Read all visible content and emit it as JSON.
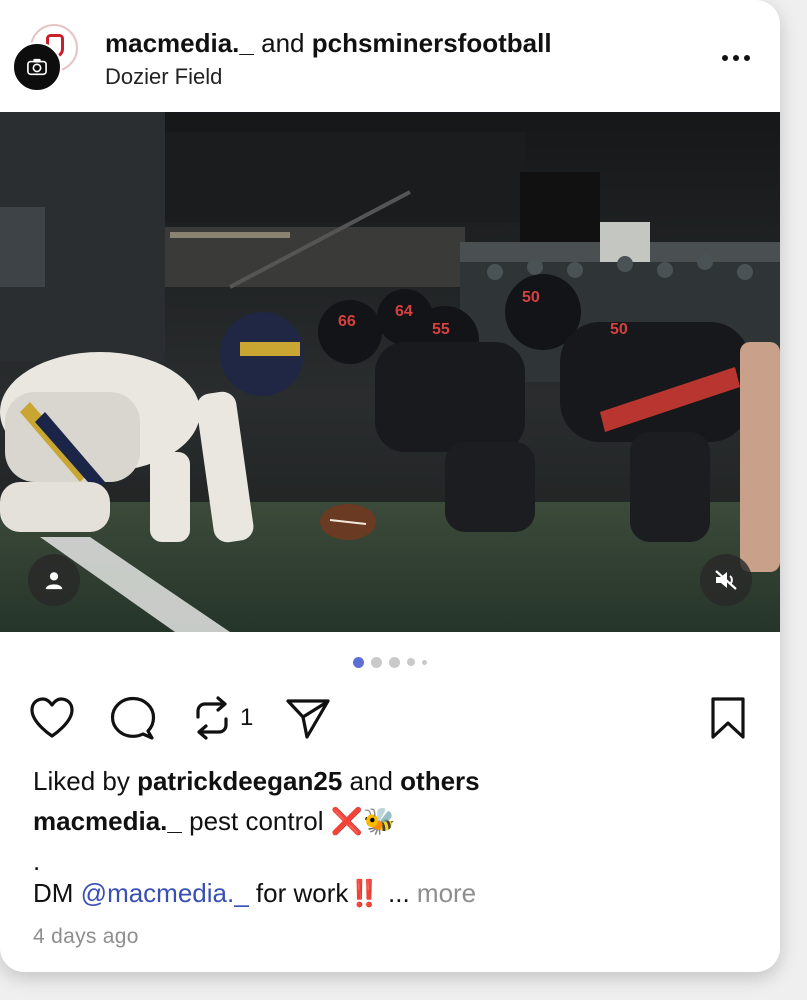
{
  "post": {
    "author_primary": "macmedia._",
    "connector": "and",
    "author_collab": "pchsminersfootball",
    "location": "Dozier Field",
    "photo_alt": "",
    "carousel": {
      "total": 5,
      "active_index": 0
    },
    "actions": {
      "like_icon": "heart-icon",
      "comment_icon": "comment-icon",
      "repost_icon": "repost-icon",
      "repost_count": "1",
      "share_icon": "send-icon",
      "save_icon": "bookmark-icon"
    },
    "liked": {
      "prefix": "Liked by",
      "user": "patrickdeegan25",
      "and": "and",
      "others": "others"
    },
    "caption": {
      "author": "macmedia._",
      "text": "pest control",
      "cross_emoji": "❌",
      "bee_emoji": "🐝",
      "dot_line": ".",
      "dm_prefix": "DM",
      "mention": "@macmedia._",
      "for_work": "for work",
      "bangs": "‼️",
      "ellipsis": "...",
      "more": "more"
    },
    "timestamp": "4 days ago"
  },
  "colors": {
    "accent_blue": "#3a4fb5",
    "muted_gray": "#8e8e8e",
    "dot_active": "#5b6fd6"
  }
}
